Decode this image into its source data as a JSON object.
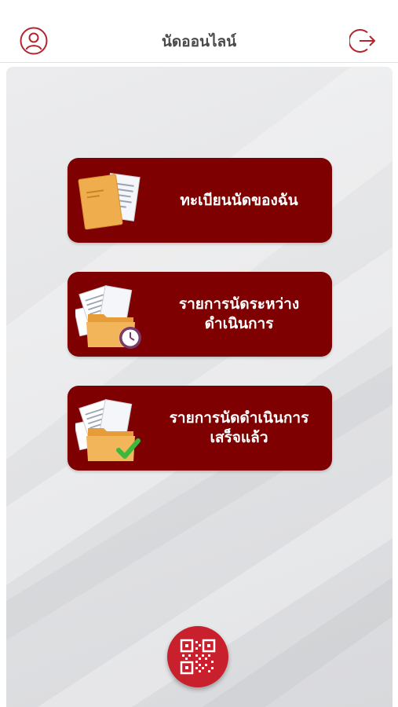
{
  "header": {
    "title": "นัดออนไลน์",
    "profile_icon": "user-circle-icon",
    "logout_icon": "logout-icon"
  },
  "menu": [
    {
      "line1": "ทะเบียนนัดของฉัน",
      "line2": "",
      "icon": "documents-icon"
    },
    {
      "line1": "รายการนัดระหว่าง",
      "line2": "ดำเนินการ",
      "icon": "folder-clock-icon"
    },
    {
      "line1": "รายการนัดดำเนินการ",
      "line2": "เสร็จแล้ว",
      "icon": "folder-check-icon"
    }
  ],
  "qr_button": {
    "icon": "qr-code-icon"
  },
  "colors": {
    "accent": "#b2252e",
    "card": "#7e0000",
    "qr_button": "#c8202c",
    "title": "#4a4a4a"
  }
}
